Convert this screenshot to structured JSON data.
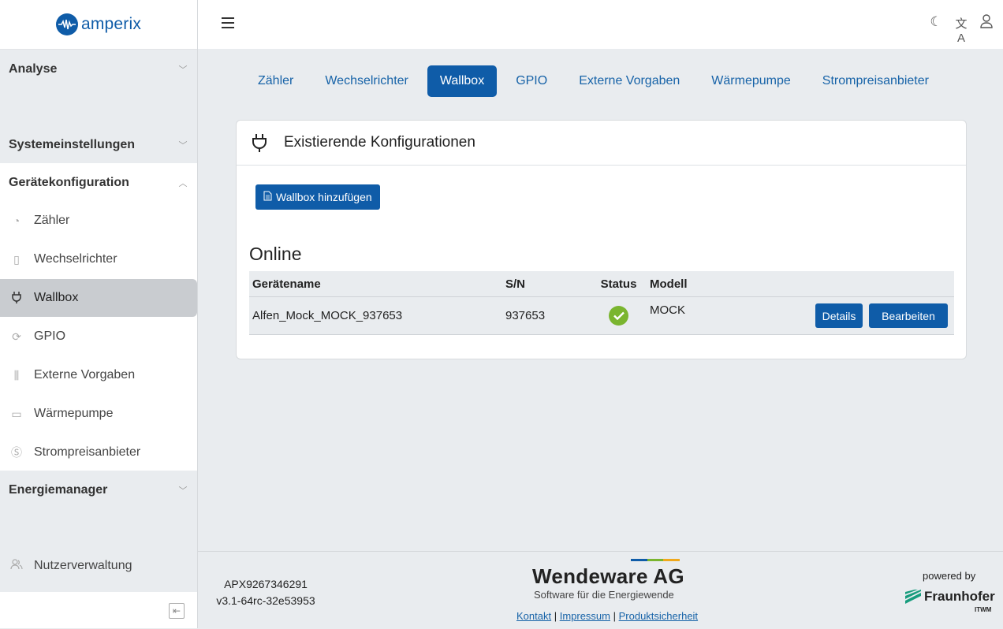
{
  "brand": {
    "name": "amperix",
    "color": "#0f5ca8"
  },
  "sidebar": {
    "sections": [
      {
        "label": "Analyse",
        "expanded": false
      },
      {
        "label": "Systemeinstellungen",
        "expanded": false
      },
      {
        "label": "Gerätekonfiguration",
        "expanded": true
      },
      {
        "label": "Energiemanager",
        "expanded": false
      }
    ],
    "items": [
      {
        "label": "Zähler",
        "icon": "meter-icon",
        "active": false
      },
      {
        "label": "Wechselrichter",
        "icon": "inverter-icon",
        "active": false
      },
      {
        "label": "Wallbox",
        "icon": "plug-icon",
        "active": true
      },
      {
        "label": "GPIO",
        "icon": "gpio-icon",
        "active": false
      },
      {
        "label": "Externe Vorgaben",
        "icon": "sliders-icon",
        "active": false
      },
      {
        "label": "Wärmepumpe",
        "icon": "heatpump-icon",
        "active": false
      },
      {
        "label": "Strompreisanbieter",
        "icon": "price-icon",
        "active": false
      }
    ],
    "user_mgmt": "Nutzerverwaltung"
  },
  "topbar": {
    "icons": [
      "menu-icon",
      "moon-icon",
      "translate-icon",
      "user-icon"
    ]
  },
  "tabs": [
    {
      "label": "Zähler",
      "active": false
    },
    {
      "label": "Wechselrichter",
      "active": false
    },
    {
      "label": "Wallbox",
      "active": true
    },
    {
      "label": "GPIO",
      "active": false
    },
    {
      "label": "Externe Vorgaben",
      "active": false
    },
    {
      "label": "Wärmepumpe",
      "active": false
    },
    {
      "label": "Strompreisanbieter",
      "active": false
    }
  ],
  "card": {
    "title": "Existierende Konfigurationen",
    "add_button": "Wallbox hinzufügen",
    "section_title": "Online",
    "columns": [
      "Gerätename",
      "S/N",
      "Status",
      "Modell"
    ],
    "rows": [
      {
        "name": "Alfen_Mock_MOCK_937653",
        "serial": "937653",
        "status": "ok",
        "model": "MOCK",
        "details_label": "Details",
        "edit_label": "Bearbeiten"
      }
    ]
  },
  "footer": {
    "device_id": "APX9267346291",
    "version": "v3.1-64rc-32e53953",
    "company": "Wendeware AG",
    "tagline": "Software für die Energiewende",
    "links": [
      "Kontakt",
      "Impressum",
      "Produktsicherheit"
    ],
    "powered_by": "powered by",
    "partner": "Fraunhofer",
    "partner_sub": "ITWM"
  },
  "colors": {
    "primary": "#0f5ca8",
    "status_ok": "#7ab52f"
  }
}
